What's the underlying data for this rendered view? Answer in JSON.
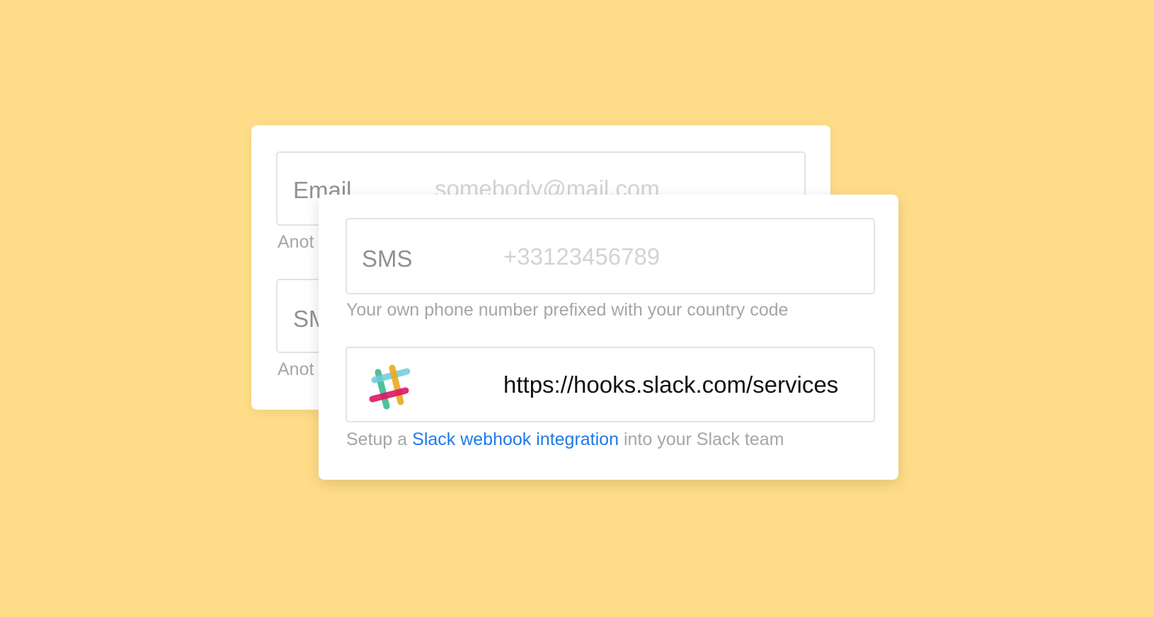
{
  "back_card": {
    "email": {
      "label": "Email",
      "placeholder": "somebody@mail.com",
      "help": "Anot"
    },
    "sms": {
      "label": "SM",
      "help": "Anot"
    }
  },
  "front_card": {
    "sms": {
      "label": "SMS",
      "placeholder": "+33123456789",
      "help": "Your own phone number prefixed with your country code"
    },
    "slack": {
      "icon": "slack-logo-icon",
      "value": "https://hooks.slack.com/services",
      "help_before": "Setup a ",
      "help_link": "Slack webhook integration",
      "help_after": " into your Slack team"
    }
  },
  "colors": {
    "background": "#FFDD88",
    "link": "#1F7AE8",
    "slack_green": "#3EB890",
    "slack_blue": "#70CADB",
    "slack_yellow": "#E9A820",
    "slack_red": "#E01563"
  }
}
